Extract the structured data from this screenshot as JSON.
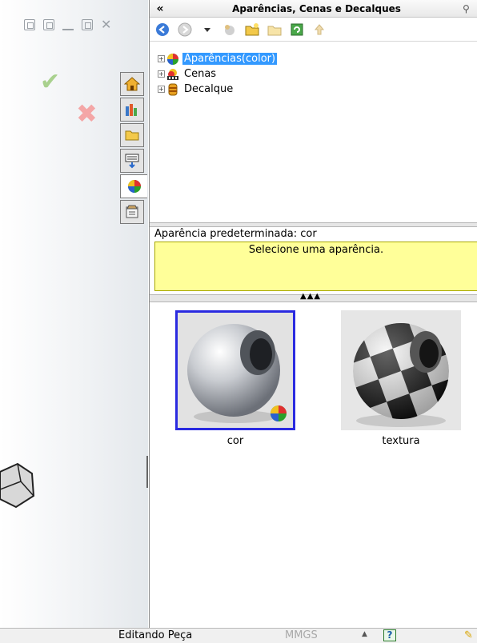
{
  "viewport": {
    "toolbar_icons": [
      "tile-left-icon",
      "tile-right-icon",
      "minimize-icon",
      "restore-icon",
      "close-icon"
    ],
    "ok_icon": "check-icon",
    "cancel_icon": "x-icon",
    "colors": {
      "ok": "#a9d18e",
      "cancel": "#f4a6a6"
    }
  },
  "tab_strip": {
    "tabs": [
      {
        "icon": "home-icon",
        "active": false
      },
      {
        "icon": "design-library-icon",
        "active": false
      },
      {
        "icon": "folder-icon",
        "active": false
      },
      {
        "icon": "view-palette-icon",
        "active": false
      },
      {
        "icon": "appearance-ball-icon",
        "active": true
      },
      {
        "icon": "custom-properties-icon",
        "active": false
      }
    ]
  },
  "panel": {
    "collapse_glyph": "«",
    "title": "Aparências, Cenas e Decalques",
    "toolbar": [
      "back-icon",
      "forward-icon",
      "dropdown-icon",
      "add-appearance-icon",
      "new-folder-icon",
      "folder-icon",
      "refresh-icon",
      "up-icon"
    ],
    "tree": [
      {
        "label": "Aparências(color)",
        "icon": "appearance-icon",
        "selected": true
      },
      {
        "label": "Cenas",
        "icon": "scenes-icon",
        "selected": false
      },
      {
        "label": "Decalque",
        "icon": "decal-icon",
        "selected": false
      }
    ],
    "info_label": "Aparência predeterminada: cor",
    "info_message": "Selecione uma aparência.",
    "gallery": [
      {
        "caption": "cor",
        "selected": true
      },
      {
        "caption": "textura",
        "selected": false
      }
    ],
    "colors": {
      "selection": "#3399ff",
      "info_bg": "#ffff99",
      "tile_border": "#2a2ae0"
    }
  },
  "status_bar": {
    "text": "Editando Peça",
    "units": "MMGS",
    "arrow": "▲",
    "help": "?"
  }
}
